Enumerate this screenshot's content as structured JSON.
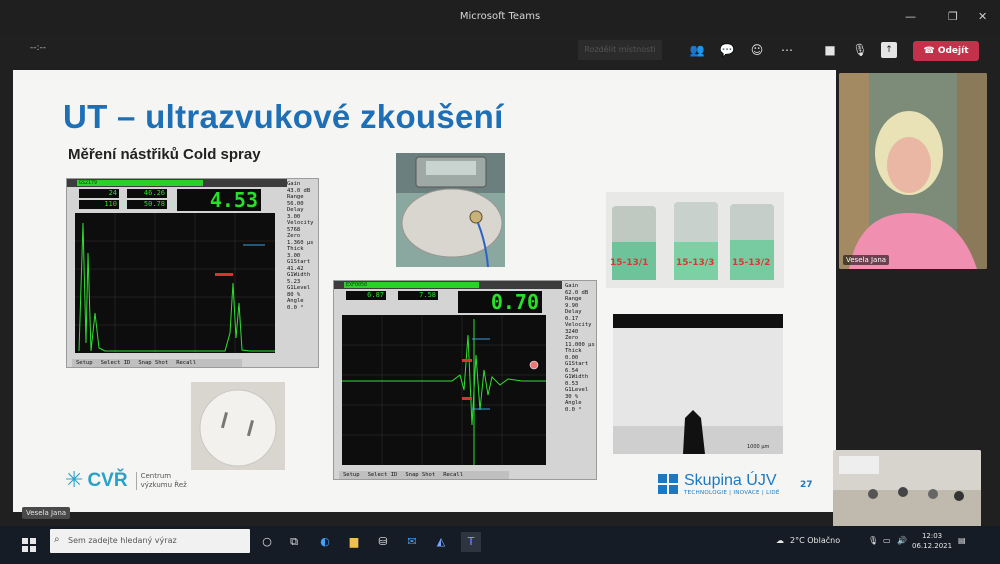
{
  "window": {
    "title": "Microsoft Teams"
  },
  "meeting": {
    "timer": "--:--",
    "breakout_label": "Rozdělit místnosti",
    "leave_label": "Odejít",
    "leave_color": "#c4314b",
    "icons": [
      "people-icon",
      "chat-icon",
      "reactions-icon",
      "more-icon",
      "camera-icon",
      "mic-icon",
      "share-icon",
      "phone-icon"
    ]
  },
  "slide": {
    "title": "UT – ultrazvukové zkoušení",
    "subtitle": "Měření nástřiků Cold spray",
    "page_number": "27",
    "title_color": "#1e6fb6",
    "scope1": {
      "id": "GS2179",
      "fields": [
        "24",
        "46.26",
        "110",
        "50.78"
      ],
      "value": "4.53",
      "tabs": [
        "Setup",
        "Select ID",
        "Snap Shot",
        "Recall"
      ],
      "params": [
        {
          "label": "Gain",
          "value": "43.0 dB"
        },
        {
          "label": "Range",
          "value": "56.00"
        },
        {
          "label": "Delay",
          "value": "3.00"
        },
        {
          "label": "Velocity",
          "value": "5768"
        },
        {
          "label": "Zero",
          "value": "1.360 µs"
        },
        {
          "label": "Thick",
          "value": "3.00"
        },
        {
          "label": "G1Start",
          "value": "41.42"
        },
        {
          "label": "G1Width",
          "value": "5.23"
        },
        {
          "label": "G1Level",
          "value": "80 %"
        },
        {
          "label": "Angle",
          "value": "0.0 °"
        }
      ]
    },
    "scope2": {
      "id": "EXF0050",
      "fields": [
        "6.87",
        "7.58"
      ],
      "value": "0.70",
      "tabs": [
        "Setup",
        "Select ID",
        "Snap Shot",
        "Recall"
      ],
      "params": [
        {
          "label": "Gain",
          "value": "62.0 dB"
        },
        {
          "label": "Range",
          "value": "9.90"
        },
        {
          "label": "Delay",
          "value": "0.17"
        },
        {
          "label": "Velocity",
          "value": "3240"
        },
        {
          "label": "Zero",
          "value": "11.000 µs"
        },
        {
          "label": "Thick",
          "value": "0.00"
        },
        {
          "label": "G1Start",
          "value": "6.54"
        },
        {
          "label": "G1Width",
          "value": "0.53"
        },
        {
          "label": "G1Level",
          "value": "30 %"
        },
        {
          "label": "Angle",
          "value": "0.0 °"
        }
      ]
    },
    "samples": [
      "15-13/1",
      "15-13/3",
      "15-13/2"
    ],
    "scale_bar": "1000 µm",
    "logo_cvr": {
      "name": "CVŘ",
      "line1": "Centrum",
      "line2": "výzkumu Řež"
    },
    "logo_ujv": {
      "name": "Skupina ÚJV",
      "tagline": "TECHNOLOGIE | INOVACE | LIDÉ"
    }
  },
  "participants": {
    "speaker_name": "Vesela Jana",
    "presenter_label": "Vesela Jana"
  },
  "taskbar": {
    "search_placeholder": "Sem zadejte hledaný výraz",
    "weather": "2°C  Oblačno",
    "time": "12:03",
    "date": "06.12.2021"
  }
}
